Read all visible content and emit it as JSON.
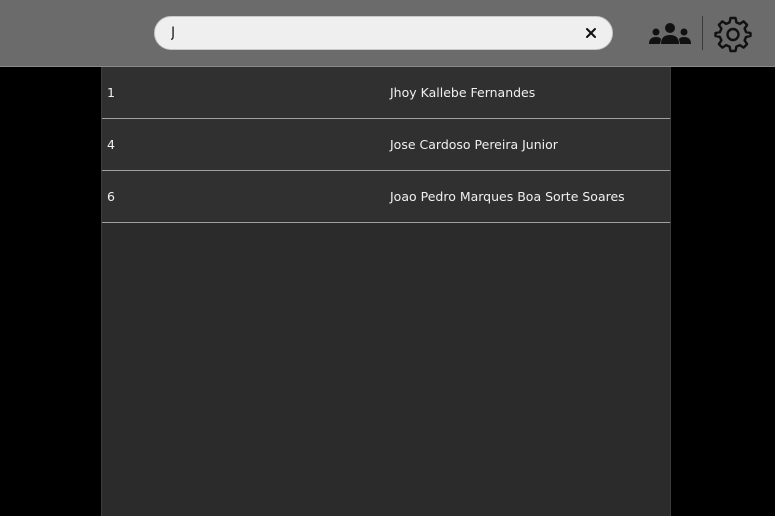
{
  "search": {
    "value": "J",
    "placeholder": ""
  },
  "icons": {
    "clear": "close-icon",
    "users": "users-group-icon",
    "settings": "gear-icon"
  },
  "colors": {
    "topbar": "#6b6b6b",
    "panel": "#2b2b2b",
    "row": "#303030",
    "row_divider": "#a0a0a0",
    "text": "#f0f0f0",
    "background": "#000000"
  },
  "results": [
    {
      "id": "1",
      "name": "Jhoy Kallebe Fernandes"
    },
    {
      "id": "4",
      "name": "Jose Cardoso Pereira Junior"
    },
    {
      "id": "6",
      "name": "Joao Pedro Marques Boa Sorte Soares"
    }
  ]
}
